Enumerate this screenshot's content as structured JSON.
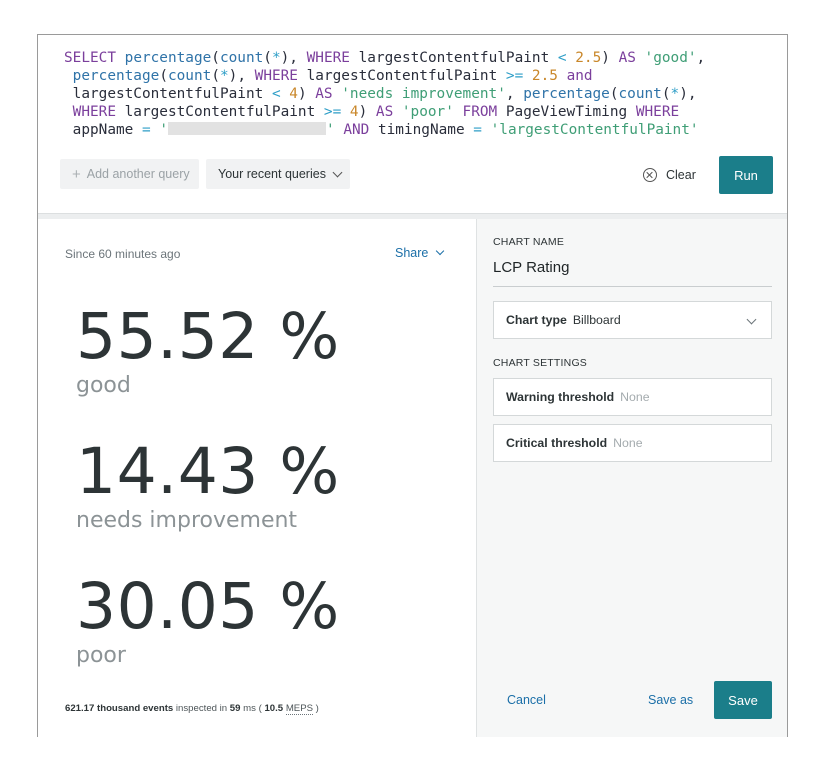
{
  "query": {
    "l1": {
      "kw1": "SELECT",
      "fn1": "percentage",
      "p1": "(",
      "fn2": "count",
      "p2": "(",
      "op1": "*",
      "p3": "), ",
      "kw2": "WHERE",
      "t1": " largestContentfulPaint ",
      "op2": "<",
      "num1": " 2.5",
      "p4": ") ",
      "kw3": "AS",
      "str1": " 'good'",
      "p5": ","
    },
    "l2": {
      "fn1": " percentage",
      "p1": "(",
      "fn2": "count",
      "p2": "(",
      "op1": "*",
      "p3": "), ",
      "kw1": "WHERE",
      "t1": " largestContentfulPaint ",
      "op2": ">=",
      "num1": " 2.5",
      "kw2": " and"
    },
    "l3": {
      "t1": " largestContentfulPaint ",
      "op1": "<",
      "num1": " 4",
      "p1": ") ",
      "kw1": "AS",
      "str1": " 'needs improvement'",
      "p2": ", ",
      "fn1": "percentage",
      "p3": "(",
      "fn2": "count",
      "p4": "(",
      "op2": "*",
      "p5": "),"
    },
    "l4": {
      "kw1": " WHERE",
      "t1": " largestContentfulPaint ",
      "op1": ">=",
      "num1": " 4",
      "p1": ") ",
      "kw2": "AS",
      "str1": " 'poor'",
      "kw3": " FROM",
      "t2": " PageViewTiming ",
      "kw4": "WHERE"
    },
    "l5": {
      "t1": " appName ",
      "op1": "=",
      "str1": " '",
      "str2": "' ",
      "kw1": "AND",
      "t2": " timingName ",
      "op2": "=",
      "str3": " 'largestContentfulPaint'"
    }
  },
  "toolbar": {
    "add_query_label": "Add another query",
    "recent_queries_label": "Your recent queries",
    "clear_label": "Clear",
    "run_label": "Run"
  },
  "billboard": {
    "since": "Since 60 minutes ago",
    "share_label": "Share",
    "metrics": [
      {
        "value": "55.52 %",
        "label": "good"
      },
      {
        "value": "14.43 %",
        "label": "needs improvement"
      },
      {
        "value": "30.05 %",
        "label": "poor"
      }
    ],
    "footer": {
      "events": "621.17 thousand events",
      "inspected_in": " inspected in ",
      "ms_value": "59",
      "ms_unit": " ms ( ",
      "meps_value": "10.5",
      "meps_unit": "MEPS",
      "close": " )"
    }
  },
  "settings": {
    "chart_name_label": "CHART NAME",
    "chart_name_value": "LCP Rating",
    "chart_type_label": "Chart type",
    "chart_type_value": "Billboard",
    "chart_settings_label": "CHART SETTINGS",
    "warning_label": "Warning threshold",
    "warning_value": "None",
    "critical_label": "Critical threshold",
    "critical_value": "None",
    "cancel_label": "Cancel",
    "save_as_label": "Save as",
    "save_label": "Save"
  },
  "colors": {
    "accent": "#1b7e8a",
    "link": "#1b6fa8",
    "keyword": "#7b3f9c",
    "function": "#2f73a8",
    "string": "#3f9e76",
    "number": "#c9872a"
  }
}
